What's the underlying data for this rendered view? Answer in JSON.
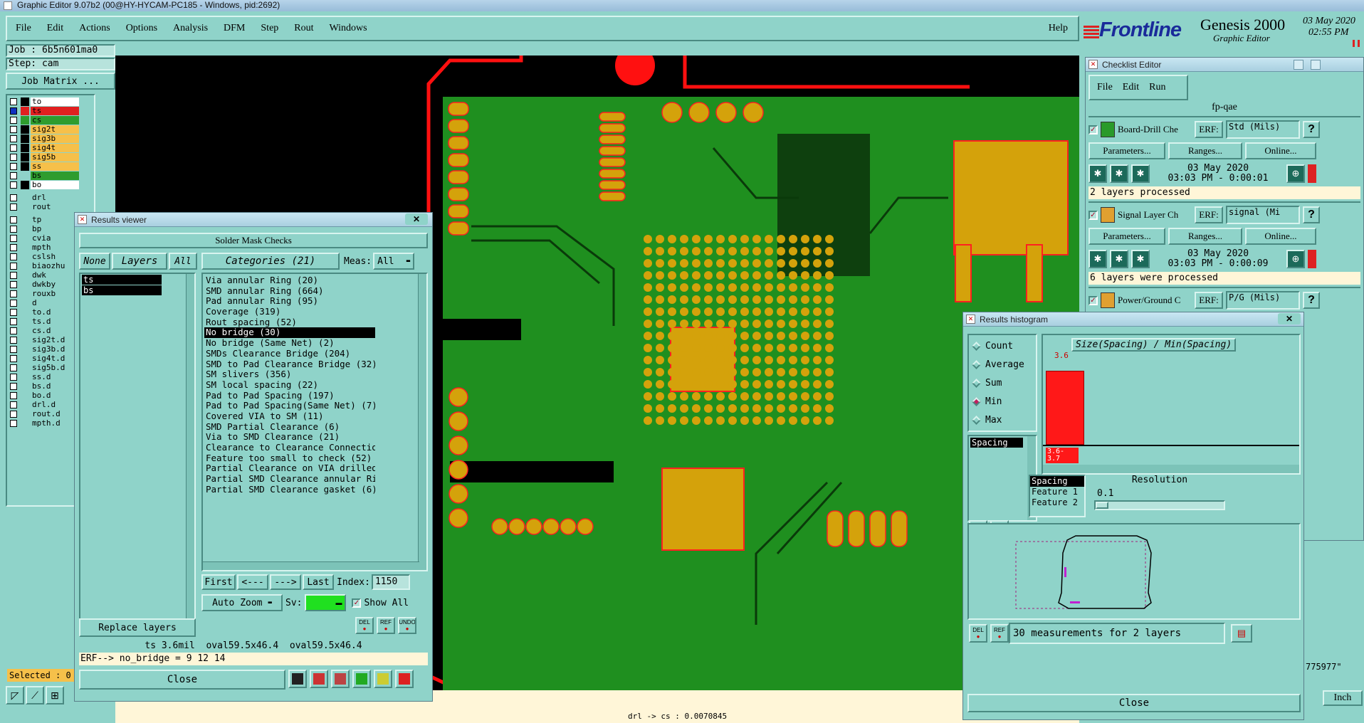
{
  "window": {
    "title": "Graphic Editor 9.07b2 (00@HY-HYCAM-PC185 - Windows, pid:2692)"
  },
  "menubar": {
    "items": [
      "File",
      "Edit",
      "Actions",
      "Options",
      "Analysis",
      "DFM",
      "Step",
      "Rout",
      "Windows"
    ],
    "help": "Help"
  },
  "brand": {
    "logo": "Frontline",
    "product": "Genesis 2000",
    "subtitle": "Graphic Editor",
    "date": "03 May 2020",
    "time": "02:55 PM"
  },
  "job": {
    "job_label": "Job : 6b5n601ma0",
    "step_label": "Step: cam",
    "matrix_button": "Job Matrix ..."
  },
  "layers": [
    {
      "name": "to",
      "color": "#ffffff"
    },
    {
      "name": "ts",
      "color": "#e02020"
    },
    {
      "name": "cs",
      "color": "#2e9c2e"
    },
    {
      "name": "sig2t",
      "color": "#f6c04a"
    },
    {
      "name": "sig3b",
      "color": "#f6c04a"
    },
    {
      "name": "sig4t",
      "color": "#f6c04a"
    },
    {
      "name": "sig5b",
      "color": "#f6c04a"
    },
    {
      "name": "ss",
      "color": "#f6c04a"
    },
    {
      "name": "bs",
      "color": "#2e9c2e"
    },
    {
      "name": "bo",
      "color": "#ffffff"
    },
    {
      "name": "drl",
      "color": ""
    },
    {
      "name": "rout",
      "color": ""
    },
    {
      "name": "tp",
      "color": ""
    },
    {
      "name": "bp",
      "color": ""
    },
    {
      "name": "cvia",
      "color": ""
    },
    {
      "name": "mpth",
      "color": ""
    },
    {
      "name": "cslsh",
      "color": ""
    },
    {
      "name": "biaozhu",
      "color": ""
    },
    {
      "name": "dwk",
      "color": ""
    },
    {
      "name": "dwkby",
      "color": ""
    },
    {
      "name": "rouxb",
      "color": ""
    },
    {
      "name": "d",
      "color": ""
    },
    {
      "name": "to.d",
      "color": ""
    },
    {
      "name": "ts.d",
      "color": ""
    },
    {
      "name": "cs.d",
      "color": ""
    },
    {
      "name": "sig2t.d",
      "color": ""
    },
    {
      "name": "sig3b.d",
      "color": ""
    },
    {
      "name": "sig4t.d",
      "color": ""
    },
    {
      "name": "sig5b.d",
      "color": ""
    },
    {
      "name": "ss.d",
      "color": ""
    },
    {
      "name": "bs.d",
      "color": ""
    },
    {
      "name": "bo.d",
      "color": ""
    },
    {
      "name": "drl.d",
      "color": ""
    },
    {
      "name": "rout.d",
      "color": ""
    },
    {
      "name": "mpth.d",
      "color": ""
    }
  ],
  "selected_label": "Selected : 0",
  "status_bar": {
    "readout": "drl -> cs : 0.0070845",
    "unit": "Inch",
    "coord_fragment": "775977\""
  },
  "results_viewer": {
    "title": "Results viewer",
    "section": "Solder Mask Checks",
    "none_btn": "None",
    "layers_label": "Layers",
    "all_btn": "All",
    "layers": [
      "ts",
      "bs"
    ],
    "categories_label": "Categories (21)",
    "meas_label": "Meas:",
    "meas_value": "All",
    "categories": [
      "Via annular Ring (20)",
      "SMD annular Ring (664)",
      "Pad annular Ring (95)",
      "Coverage (319)",
      "Rout spacing (52)",
      "No bridge (30)",
      "No bridge (Same Net) (2)",
      "SMDs Clearance Bridge (204)",
      "SMD to Pad Clearance Bridge (32)",
      "SM slivers (356)",
      "SM local spacing (22)",
      "Pad to Pad Spacing (197)",
      "Pad to Pad Spacing(Same Net) (7)",
      "Covered VIA to SM (11)",
      "SMD Partial Clearance (6)",
      "Via to SMD Clearance (21)",
      "Clearance to Clearance Connection",
      "Feature too small to check (52)",
      "Partial Clearance on VIA drilled",
      "Partial SMD Clearance annular Rin",
      "Partial SMD Clearance gasket (6)"
    ],
    "selected_category": "No bridge (30)",
    "nav": {
      "first": "First",
      "prev": "<---",
      "next": "--->",
      "last": "Last",
      "index_label": "Index:",
      "index_value": "1150"
    },
    "auto_zoom": "Auto Zoom",
    "sv_label": "Sv:",
    "show_all": "Show All",
    "replace_layers": "Replace layers",
    "icon_btns": [
      "DEL",
      "REF",
      "UNDO"
    ],
    "info_line": "ts 3.6mil  oval59.5x46.4  oval59.5x46.4",
    "erf_line": "ERF--> no_bridge = 9 12 14",
    "close": "Close"
  },
  "checklist": {
    "title": "Checklist Editor",
    "menu": [
      "File",
      "Edit",
      "Run"
    ],
    "name": "fp-qae",
    "items": [
      {
        "name": "Board-Drill Che",
        "erf_label": "ERF:",
        "erf_value": "Std (Mils)",
        "params": "Parameters...",
        "ranges": "Ranges...",
        "online": "Online...",
        "date": "03 May 2020",
        "time": "03:03 PM - 0:00:01",
        "status": "2 layers processed"
      },
      {
        "name": "Signal Layer Ch",
        "erf_label": "ERF:",
        "erf_value": "signal (Mi",
        "params": "Parameters...",
        "ranges": "Ranges...",
        "online": "Online...",
        "date": "03 May 2020",
        "time": "03:03 PM - 0:00:09",
        "status": "6 layers were processed"
      },
      {
        "name": "Power/Ground C",
        "erf_label": "ERF:",
        "erf_value": "P/G (Mils)"
      }
    ],
    "help": "?"
  },
  "histogram": {
    "title": "Results histogram",
    "modes": [
      "Count",
      "Average",
      "Sum",
      "Min",
      "Max"
    ],
    "selected_mode": "Min",
    "title_box": "Size(Spacing) / Min(Spacing)",
    "list": [
      "Spacing"
    ],
    "bar_value": "3.6",
    "bar_range": "3.6- 3.7",
    "bar_fraction": 1.0,
    "fields": [
      "Spacing",
      "Feature 1",
      "Feature 2"
    ],
    "resolution_label": "Resolution",
    "resolution_value": "0.1",
    "icon_btns": [
      "DEL",
      "REF"
    ],
    "measurements": "30 measurements for 2 layers",
    "close": "Close"
  }
}
